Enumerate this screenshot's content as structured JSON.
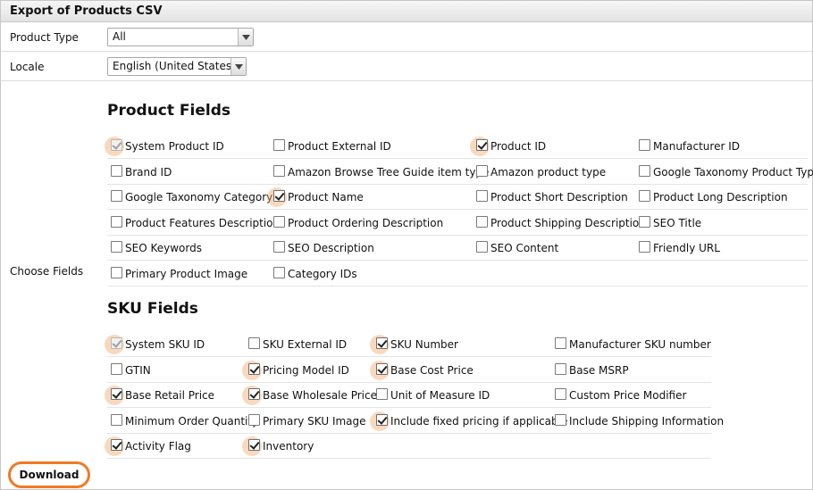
{
  "header": {
    "title": "Export of Products CSV"
  },
  "filters": {
    "product_type": {
      "label": "Product Type",
      "value": "All"
    },
    "locale": {
      "label": "Locale",
      "value": "English (United States)"
    }
  },
  "choose_fields_label": "Choose Fields",
  "product_fields": {
    "title": "Product Fields",
    "items": [
      {
        "label": "System Product ID",
        "checked": true,
        "disabled": true
      },
      {
        "label": "Product External ID",
        "checked": false
      },
      {
        "label": "Product ID",
        "checked": true
      },
      {
        "label": "Manufacturer ID",
        "checked": false
      },
      {
        "label": "Brand ID",
        "checked": false
      },
      {
        "label": "Amazon Browse Tree Guide item type",
        "checked": false
      },
      {
        "label": "Amazon product type",
        "checked": false
      },
      {
        "label": "Google Taxonomy Product Type",
        "checked": false
      },
      {
        "label": "Google Taxonomy Category",
        "checked": false
      },
      {
        "label": "Product Name",
        "checked": true
      },
      {
        "label": "Product Short Description",
        "checked": false
      },
      {
        "label": "Product Long Description",
        "checked": false
      },
      {
        "label": "Product Features Description",
        "checked": false
      },
      {
        "label": "Product Ordering Description",
        "checked": false
      },
      {
        "label": "Product Shipping Description",
        "checked": false
      },
      {
        "label": "SEO Title",
        "checked": false
      },
      {
        "label": "SEO Keywords",
        "checked": false
      },
      {
        "label": "SEO Description",
        "checked": false
      },
      {
        "label": "SEO Content",
        "checked": false
      },
      {
        "label": "Friendly URL",
        "checked": false
      },
      {
        "label": "Primary Product Image",
        "checked": false
      },
      {
        "label": "Category IDs",
        "checked": false
      }
    ]
  },
  "sku_fields": {
    "title": "SKU Fields",
    "items": [
      {
        "label": "System SKU ID",
        "checked": true,
        "disabled": true
      },
      {
        "label": "SKU External ID",
        "checked": false
      },
      {
        "label": "SKU Number",
        "checked": true
      },
      {
        "label": "Manufacturer SKU number",
        "checked": false
      },
      {
        "label": "GTIN",
        "checked": false
      },
      {
        "label": "Pricing Model ID",
        "checked": true
      },
      {
        "label": "Base Cost Price",
        "checked": true
      },
      {
        "label": "Base MSRP",
        "checked": false
      },
      {
        "label": "Base Retail Price",
        "checked": true
      },
      {
        "label": "Base Wholesale Price",
        "checked": true
      },
      {
        "label": "Unit of Measure ID",
        "checked": false
      },
      {
        "label": "Custom Price Modifier",
        "checked": false
      },
      {
        "label": "Minimum Order Quantity",
        "checked": false
      },
      {
        "label": "Primary SKU Image",
        "checked": false
      },
      {
        "label": "Include fixed pricing if applicable",
        "checked": true
      },
      {
        "label": "Include Shipping Information",
        "checked": false
      },
      {
        "label": "Activity Flag",
        "checked": true
      },
      {
        "label": "Inventory",
        "checked": true
      }
    ]
  },
  "download_label": "Download",
  "colors": {
    "highlight": "#f2aa6e",
    "download_ring": "#f07a22"
  }
}
